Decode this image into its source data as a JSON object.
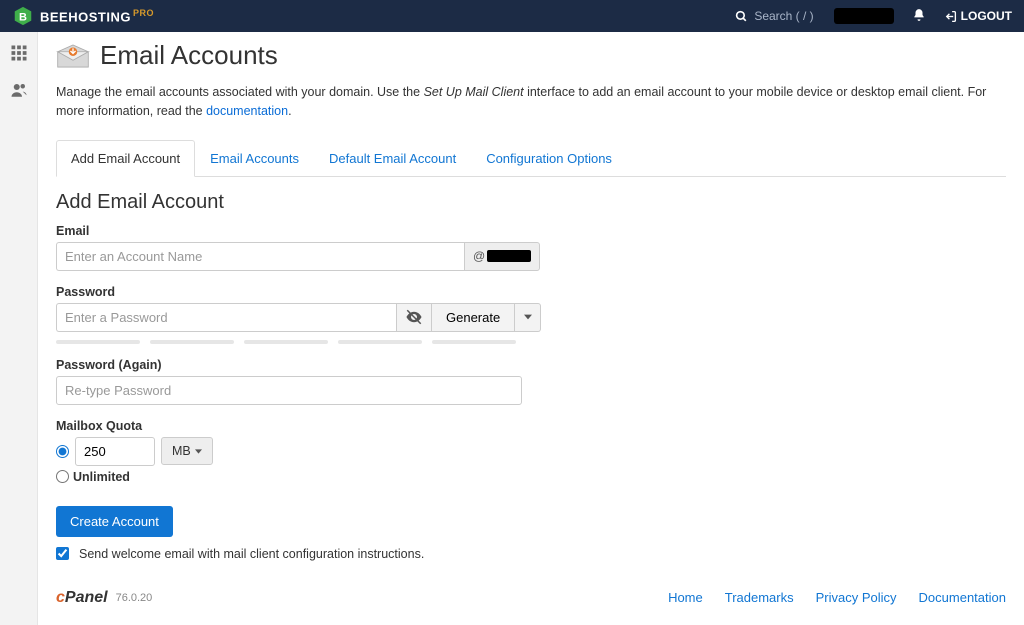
{
  "topbar": {
    "brand": "BEEHOSTING",
    "brand_suffix": "PRO",
    "search_placeholder": "Search ( / )",
    "logout": "LOGOUT"
  },
  "page": {
    "title": "Email Accounts",
    "intro_pre": "Manage the email accounts associated with your domain. Use the ",
    "intro_em": "Set Up Mail Client",
    "intro_post": " interface to add an email account to your mobile device or desktop email client. For more information, read the ",
    "doc_link": "documentation",
    "intro_end": "."
  },
  "tabs": [
    {
      "label": "Add Email Account",
      "active": true
    },
    {
      "label": "Email Accounts",
      "active": false
    },
    {
      "label": "Default Email Account",
      "active": false
    },
    {
      "label": "Configuration Options",
      "active": false
    }
  ],
  "form": {
    "section_title": "Add Email Account",
    "email_label": "Email",
    "email_placeholder": "Enter an Account Name",
    "domain_prefix": "@",
    "password_label": "Password",
    "password_placeholder": "Enter a Password",
    "generate_label": "Generate",
    "password2_label": "Password (Again)",
    "password2_placeholder": "Re-type Password",
    "quota_label": "Mailbox Quota",
    "quota_value": "250",
    "quota_unit": "MB",
    "unlimited_label": "Unlimited",
    "create_label": "Create Account",
    "welcome_label": "Send welcome email with mail client configuration instructions."
  },
  "footer": {
    "brand1": "c",
    "brand2": "Panel",
    "version": "76.0.20",
    "links": [
      "Home",
      "Trademarks",
      "Privacy Policy",
      "Documentation"
    ]
  }
}
